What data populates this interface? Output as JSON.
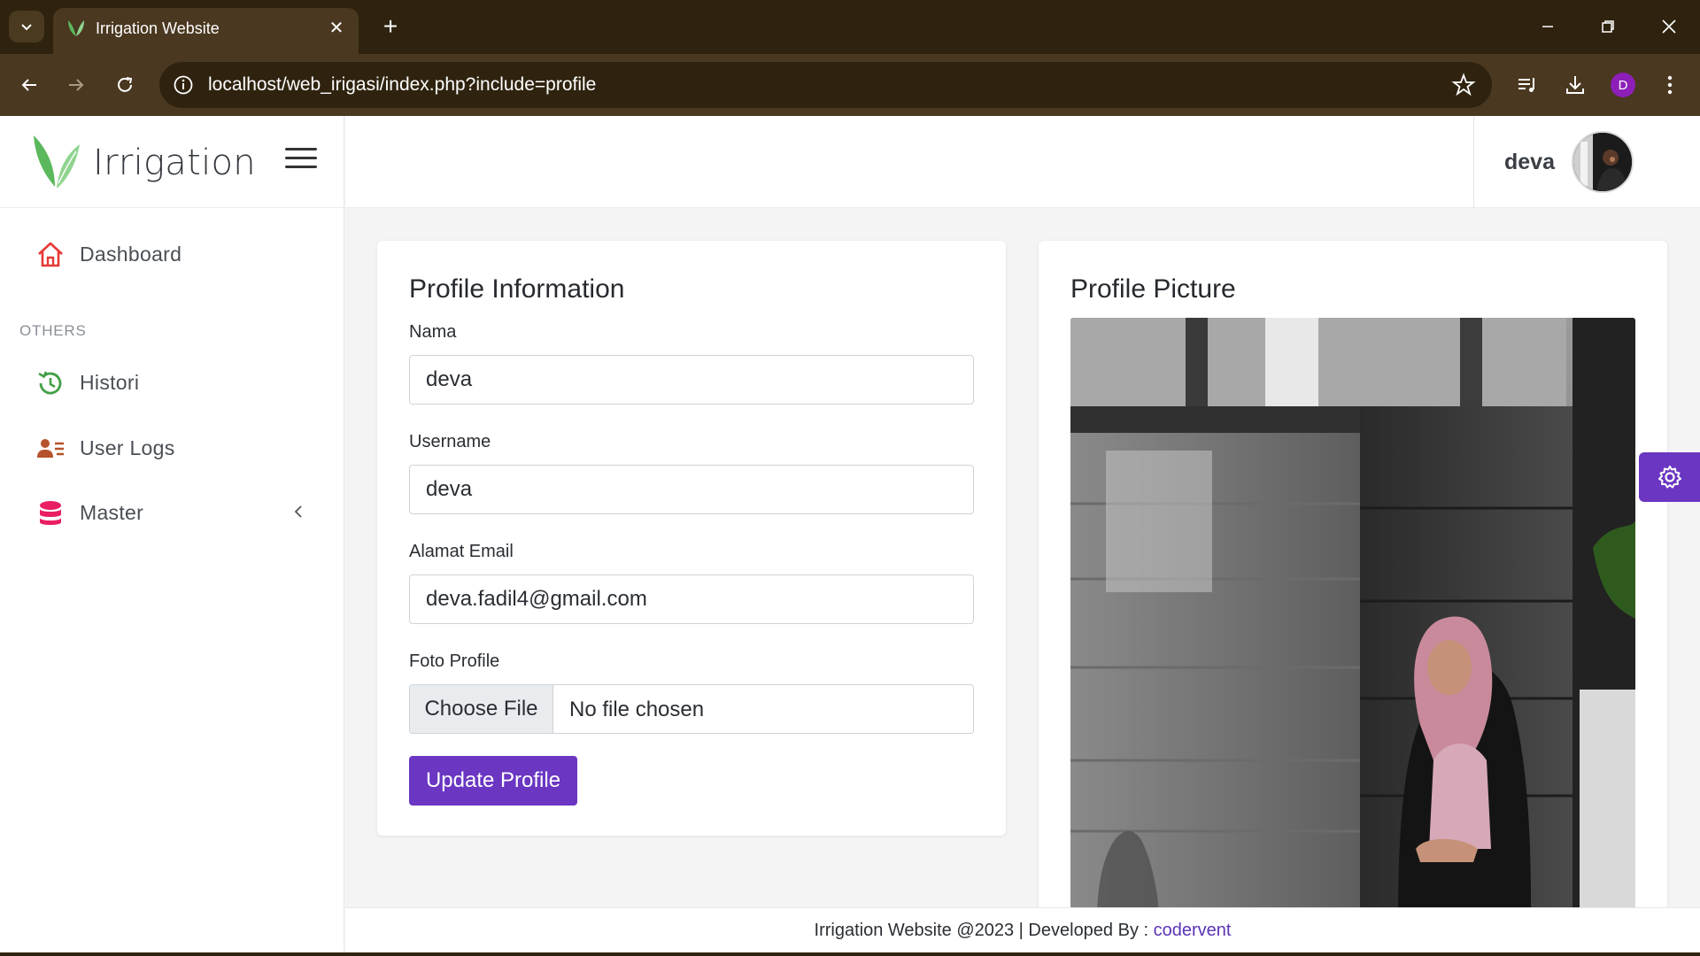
{
  "browser": {
    "tab_title": "Irrigation Website",
    "url": "localhost/web_irigasi/index.php?include=profile",
    "profile_initial": "D",
    "icons": {
      "tab_list": "chevron-down-icon",
      "close": "close-icon",
      "new_tab": "plus-icon",
      "back": "back-arrow-icon",
      "forward": "forward-arrow-icon",
      "reload": "reload-icon",
      "site_info": "info-icon",
      "bookmark": "star-icon",
      "media": "media-queue-icon",
      "download": "download-icon",
      "menu": "kebab-menu-icon"
    }
  },
  "brand": {
    "name": "Irrigation",
    "accent": "#6a36c2",
    "logo_color": "#5bb85c"
  },
  "sidebar": {
    "items": [
      {
        "label": "Dashboard",
        "icon": "home-icon",
        "color": "#e53935"
      },
      {
        "label": "Histori",
        "icon": "history-icon",
        "color": "#43a047"
      },
      {
        "label": "User Logs",
        "icon": "user-list-icon",
        "color": "#b5532b"
      },
      {
        "label": "Master",
        "icon": "database-icon",
        "color": "#e91e63"
      }
    ],
    "section_header": "OTHERS"
  },
  "header": {
    "username": "deva"
  },
  "profile_form": {
    "title": "Profile Information",
    "fields": [
      {
        "label": "Nama",
        "value": "deva"
      },
      {
        "label": "Username",
        "value": "deva"
      },
      {
        "label": "Alamat Email",
        "value": "deva.fadil4@gmail.com"
      }
    ],
    "photo_label": "Foto Profile",
    "file_button": "Choose File",
    "file_status": "No file chosen",
    "submit": "Update Profile"
  },
  "profile_picture": {
    "title": "Profile Picture"
  },
  "footer": {
    "text": "Irrigation Website @2023 | Developed By : ",
    "link": "codervent"
  }
}
